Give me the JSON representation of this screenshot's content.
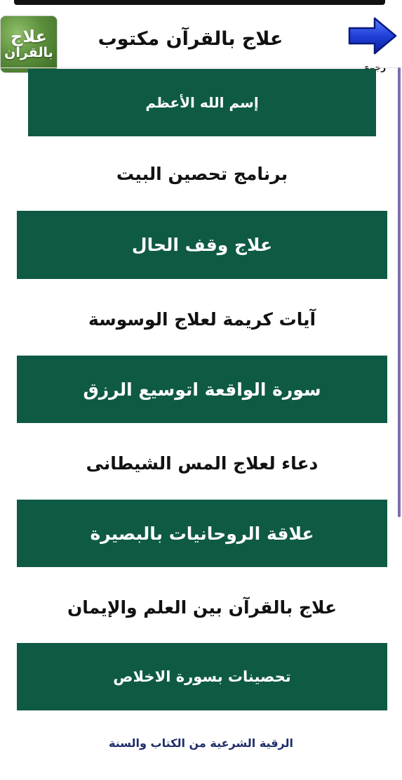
{
  "header": {
    "logo_line1": "علاج",
    "logo_line2": "بالقرآن",
    "title": "علاج بالقرآن مكتوب",
    "back_label": "رجوع"
  },
  "colors": {
    "green": "#0e5a45",
    "arrow_blue": "#2040d8",
    "footer_text": "#1f2d6b"
  },
  "menu": [
    {
      "label": "إسم الله الأعظم",
      "style": "green"
    },
    {
      "label": "برنامج تحصين البيت",
      "style": "white"
    },
    {
      "label": "علاج وقف الحال",
      "style": "green"
    },
    {
      "label": "آيات كريمة لعلاج الوسوسة",
      "style": "white"
    },
    {
      "label": "سورة الواقعة اتوسيع الرزق",
      "style": "green"
    },
    {
      "label": "دعاء لعلاج المس الشيطانى",
      "style": "white"
    },
    {
      "label": "علاقة الروحانيات بالبصيرة",
      "style": "green"
    },
    {
      "label": "علاج بالقرآن بين العلم والإيمان",
      "style": "white"
    },
    {
      "label": "تحصينات بسورة الاخلاص",
      "style": "green"
    }
  ],
  "footer": {
    "text": "الرقية الشرعية من الكتاب والسنة"
  }
}
